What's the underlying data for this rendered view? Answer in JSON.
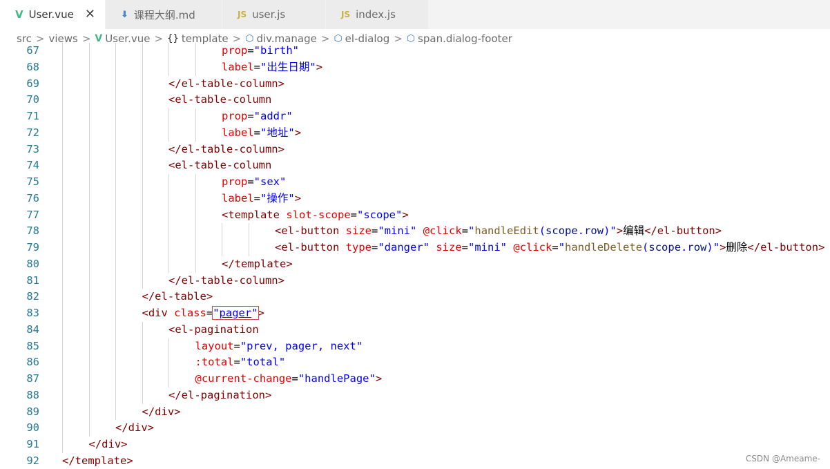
{
  "tabs": [
    {
      "label": "User.vue",
      "icon": "vue-icon",
      "active": true,
      "close_glyph": "✕"
    },
    {
      "label": "课程大纲.md",
      "icon": "markdown-download-icon",
      "active": false
    },
    {
      "label": "user.js",
      "icon": "js-icon",
      "active": false
    },
    {
      "label": "index.js",
      "icon": "js-icon",
      "active": false
    }
  ],
  "breadcrumb": [
    "src",
    "views",
    "User.vue",
    "template",
    "div.manage",
    "el-dialog",
    "span.dialog-footer"
  ],
  "code_lines": [
    {
      "n": "67",
      "indent": 6,
      "tokens": [
        [
          "attr",
          "prop"
        ],
        [
          "txt",
          "="
        ],
        [
          "str",
          "\"birth\""
        ]
      ]
    },
    {
      "n": "68",
      "indent": 6,
      "tokens": [
        [
          "attr",
          "label"
        ],
        [
          "txt",
          "="
        ],
        [
          "str",
          "\"出生日期\""
        ],
        [
          "tag",
          ">"
        ]
      ]
    },
    {
      "n": "69",
      "indent": 4,
      "tokens": [
        [
          "tag",
          "</el-table-column>"
        ]
      ]
    },
    {
      "n": "70",
      "indent": 4,
      "tokens": [
        [
          "tag",
          "<el-table-column"
        ]
      ]
    },
    {
      "n": "71",
      "indent": 6,
      "tokens": [
        [
          "attr",
          "prop"
        ],
        [
          "txt",
          "="
        ],
        [
          "str",
          "\"addr\""
        ]
      ]
    },
    {
      "n": "72",
      "indent": 6,
      "tokens": [
        [
          "attr",
          "label"
        ],
        [
          "txt",
          "="
        ],
        [
          "str",
          "\"地址\""
        ],
        [
          "tag",
          ">"
        ]
      ]
    },
    {
      "n": "73",
      "indent": 4,
      "tokens": [
        [
          "tag",
          "</el-table-column>"
        ]
      ]
    },
    {
      "n": "74",
      "indent": 4,
      "tokens": [
        [
          "tag",
          "<el-table-column"
        ]
      ]
    },
    {
      "n": "75",
      "indent": 6,
      "tokens": [
        [
          "attr",
          "prop"
        ],
        [
          "txt",
          "="
        ],
        [
          "str",
          "\"sex\""
        ]
      ]
    },
    {
      "n": "76",
      "indent": 6,
      "tokens": [
        [
          "attr",
          "label"
        ],
        [
          "txt",
          "="
        ],
        [
          "str",
          "\"操作\""
        ],
        [
          "tag",
          ">"
        ]
      ]
    },
    {
      "n": "77",
      "indent": 6,
      "tokens": [
        [
          "tag",
          "<template"
        ],
        [
          "txt",
          " "
        ],
        [
          "attr",
          "slot-scope"
        ],
        [
          "txt",
          "="
        ],
        [
          "str",
          "\"scope\""
        ],
        [
          "tag",
          ">"
        ]
      ]
    },
    {
      "n": "78",
      "indent": 8,
      "tokens": [
        [
          "tag",
          "<el-button"
        ],
        [
          "txt",
          " "
        ],
        [
          "attr",
          "size"
        ],
        [
          "txt",
          "="
        ],
        [
          "str",
          "\"mini\""
        ],
        [
          "txt",
          " "
        ],
        [
          "attr",
          "@click"
        ],
        [
          "txt",
          "="
        ],
        [
          "str",
          "\""
        ],
        [
          "fn",
          "handleEdit"
        ],
        [
          "str",
          "("
        ],
        [
          "var",
          "scope"
        ],
        [
          "str",
          "."
        ],
        [
          "var",
          "row"
        ],
        [
          "str",
          ")\""
        ],
        [
          "tag",
          ">"
        ],
        [
          "txt",
          "编辑"
        ],
        [
          "tag",
          "</el-button>"
        ]
      ]
    },
    {
      "n": "79",
      "indent": 8,
      "tokens": [
        [
          "tag",
          "<el-button"
        ],
        [
          "txt",
          " "
        ],
        [
          "attr",
          "type"
        ],
        [
          "txt",
          "="
        ],
        [
          "str",
          "\"danger\""
        ],
        [
          "txt",
          " "
        ],
        [
          "attr",
          "size"
        ],
        [
          "txt",
          "="
        ],
        [
          "str",
          "\"mini\""
        ],
        [
          "txt",
          " "
        ],
        [
          "attr",
          "@click"
        ],
        [
          "txt",
          "="
        ],
        [
          "str",
          "\""
        ],
        [
          "fn",
          "handleDelete"
        ],
        [
          "str",
          "("
        ],
        [
          "var",
          "scope"
        ],
        [
          "str",
          "."
        ],
        [
          "var",
          "row"
        ],
        [
          "str",
          ")\""
        ],
        [
          "tag",
          ">"
        ],
        [
          "txt",
          "删除"
        ],
        [
          "tag",
          "</el-button>"
        ]
      ]
    },
    {
      "n": "80",
      "indent": 6,
      "tokens": [
        [
          "tag",
          "</template>"
        ]
      ]
    },
    {
      "n": "81",
      "indent": 4,
      "tokens": [
        [
          "tag",
          "</el-table-column>"
        ]
      ]
    },
    {
      "n": "82",
      "indent": 3,
      "tokens": [
        [
          "tag",
          "</el-table>"
        ]
      ]
    },
    {
      "n": "83",
      "indent": 3,
      "tokens": [
        [
          "tag",
          "<div"
        ],
        [
          "txt",
          " "
        ],
        [
          "attr",
          "class"
        ],
        [
          "txt",
          "="
        ],
        [
          "str-hl",
          "\"pager\""
        ],
        [
          "tag",
          ">"
        ]
      ]
    },
    {
      "n": "84",
      "indent": 4,
      "tokens": [
        [
          "tag",
          "<el-pagination"
        ]
      ]
    },
    {
      "n": "85",
      "indent": 5,
      "tokens": [
        [
          "attr",
          "layout"
        ],
        [
          "txt",
          "="
        ],
        [
          "str",
          "\"prev, pager, next\""
        ]
      ]
    },
    {
      "n": "86",
      "indent": 5,
      "tokens": [
        [
          "attr",
          ":total"
        ],
        [
          "txt",
          "="
        ],
        [
          "str",
          "\"total\""
        ]
      ]
    },
    {
      "n": "87",
      "indent": 5,
      "tokens": [
        [
          "attr",
          "@current-change"
        ],
        [
          "txt",
          "="
        ],
        [
          "str",
          "\"handlePage\""
        ],
        [
          "tag",
          ">"
        ]
      ]
    },
    {
      "n": "88",
      "indent": 4,
      "tokens": [
        [
          "tag",
          "</el-pagination>"
        ]
      ]
    },
    {
      "n": "89",
      "indent": 3,
      "tokens": [
        [
          "tag",
          "</div>"
        ]
      ]
    },
    {
      "n": "90",
      "indent": 2,
      "tokens": [
        [
          "tag",
          "</div>"
        ]
      ]
    },
    {
      "n": "91",
      "indent": 1,
      "tokens": [
        [
          "tag",
          "</div>"
        ]
      ]
    },
    {
      "n": "92",
      "indent": 0,
      "tokens": [
        [
          "tag",
          "</template>"
        ]
      ]
    }
  ],
  "watermark": "CSDN @Ameame-"
}
